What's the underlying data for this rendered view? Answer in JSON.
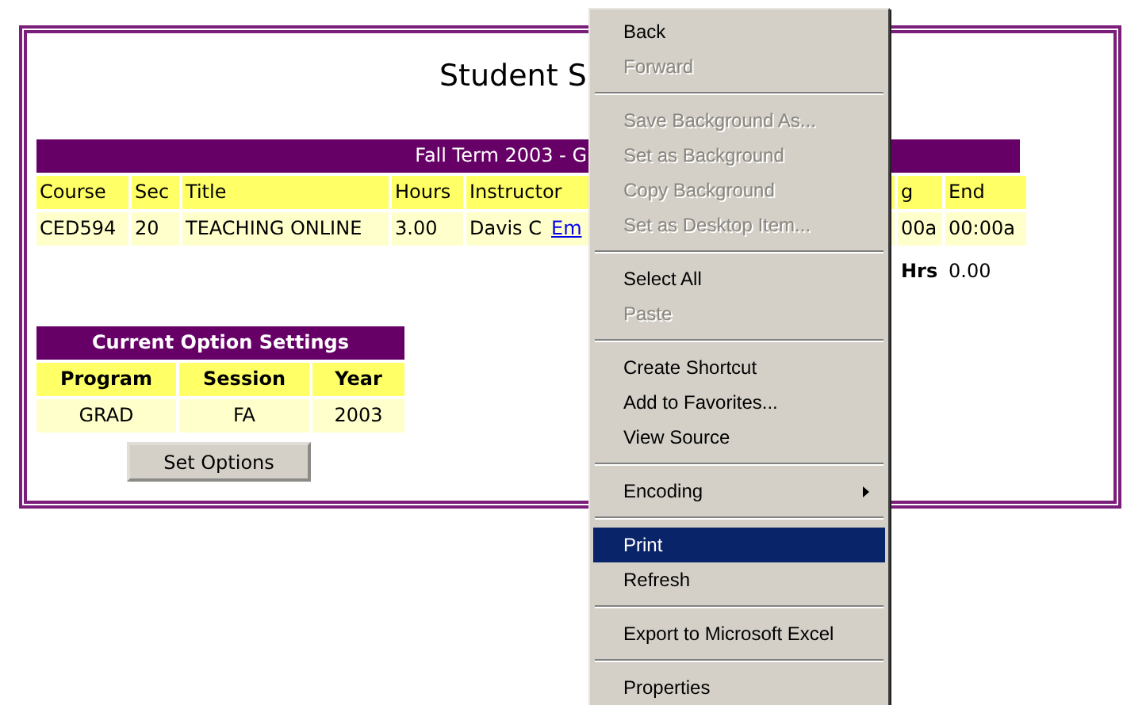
{
  "page": {
    "title": "Student S",
    "term_header": "Fall Term 2003 - G",
    "courses": {
      "columns": [
        "Course",
        "Sec",
        "Title",
        "Hours",
        "Instructor",
        "g",
        "End"
      ],
      "rows": [
        {
          "course": "CED594",
          "sec": "20",
          "title": "TEACHING ONLINE",
          "hours": "3.00",
          "instructor": "Davis C",
          "email_link": "Em",
          "column_6": "00a",
          "end": "00:00a"
        }
      ],
      "total_label": "Hrs",
      "total_value": "0.00"
    },
    "options": {
      "title": "Current Option Settings",
      "columns": [
        "Program",
        "Session",
        "Year"
      ],
      "values": [
        "GRAD",
        "FA",
        "2003"
      ],
      "button": "Set Options"
    }
  },
  "context_menu": {
    "items": [
      {
        "kind": "item",
        "label": "Back",
        "disabled": false,
        "selected": false,
        "submenu": false
      },
      {
        "kind": "item",
        "label": "Forward",
        "disabled": true,
        "selected": false,
        "submenu": false
      },
      {
        "kind": "separator"
      },
      {
        "kind": "item",
        "label": "Save Background As...",
        "disabled": true,
        "selected": false,
        "submenu": false
      },
      {
        "kind": "item",
        "label": "Set as Background",
        "disabled": true,
        "selected": false,
        "submenu": false
      },
      {
        "kind": "item",
        "label": "Copy Background",
        "disabled": true,
        "selected": false,
        "submenu": false
      },
      {
        "kind": "item",
        "label": "Set as Desktop Item...",
        "disabled": true,
        "selected": false,
        "submenu": false
      },
      {
        "kind": "separator"
      },
      {
        "kind": "item",
        "label": "Select All",
        "disabled": false,
        "selected": false,
        "submenu": false
      },
      {
        "kind": "item",
        "label": "Paste",
        "disabled": true,
        "selected": false,
        "submenu": false
      },
      {
        "kind": "separator"
      },
      {
        "kind": "item",
        "label": "Create Shortcut",
        "disabled": false,
        "selected": false,
        "submenu": false
      },
      {
        "kind": "item",
        "label": "Add to Favorites...",
        "disabled": false,
        "selected": false,
        "submenu": false
      },
      {
        "kind": "item",
        "label": "View Source",
        "disabled": false,
        "selected": false,
        "submenu": false
      },
      {
        "kind": "separator"
      },
      {
        "kind": "item",
        "label": "Encoding",
        "disabled": false,
        "selected": false,
        "submenu": true
      },
      {
        "kind": "separator"
      },
      {
        "kind": "item",
        "label": "Print",
        "disabled": false,
        "selected": true,
        "submenu": false
      },
      {
        "kind": "item",
        "label": "Refresh",
        "disabled": false,
        "selected": false,
        "submenu": false
      },
      {
        "kind": "separator"
      },
      {
        "kind": "item",
        "label": "Export to Microsoft Excel",
        "disabled": false,
        "selected": false,
        "submenu": false
      },
      {
        "kind": "separator"
      },
      {
        "kind": "item",
        "label": "Properties",
        "disabled": false,
        "selected": false,
        "submenu": false
      }
    ]
  }
}
